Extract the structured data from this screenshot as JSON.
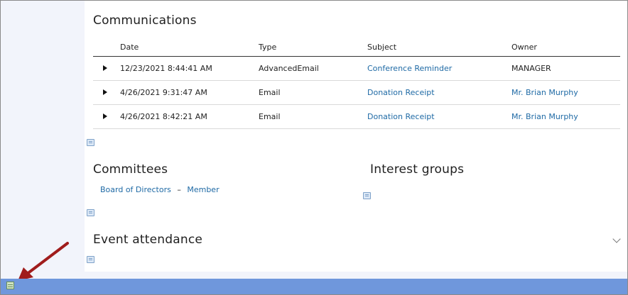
{
  "communications": {
    "title": "Communications",
    "columns": [
      "Date",
      "Type",
      "Subject",
      "Owner"
    ],
    "rows": [
      {
        "date": "12/23/2021 8:44:41 AM",
        "type": "AdvancedEmail",
        "subject": "Conference Reminder",
        "owner": "MANAGER"
      },
      {
        "date": "4/26/2021 9:31:47 AM",
        "type": "Email",
        "subject": "Donation Receipt",
        "owner": "Mr. Brian Murphy"
      },
      {
        "date": "4/26/2021 8:42:21 AM",
        "type": "Email",
        "subject": "Donation Receipt",
        "owner": "Mr. Brian Murphy"
      }
    ]
  },
  "committees": {
    "title": "Committees",
    "item": "Board of Directors",
    "separator": "–",
    "role": "Member"
  },
  "interest_groups": {
    "title": "Interest groups"
  },
  "event_attendance": {
    "title": "Event attendance"
  },
  "colors": {
    "link": "#1f6aa5",
    "bottom_bar": "#6f97dc",
    "annotation_arrow": "#a01c1c"
  },
  "icons": [
    "expand-row-arrow-icon",
    "edit-content-icon",
    "chevron-down-icon",
    "page-settings-icon",
    "annotation-arrow"
  ]
}
